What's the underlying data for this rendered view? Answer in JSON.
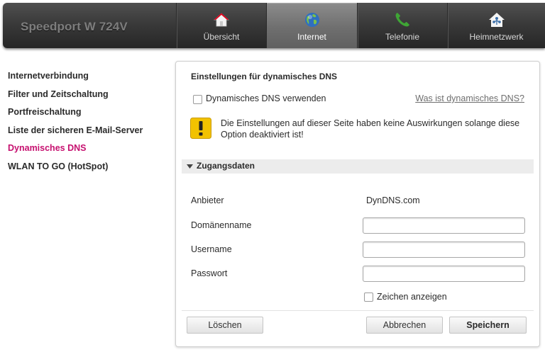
{
  "header": {
    "brand": "Speedport W 724V",
    "tabs": [
      {
        "label": "Übersicht",
        "icon": "home-icon",
        "active": false
      },
      {
        "label": "Internet",
        "icon": "globe-icon",
        "active": true
      },
      {
        "label": "Telefonie",
        "icon": "phone-icon",
        "active": false
      },
      {
        "label": "Heimnetzwerk",
        "icon": "home-network-icon",
        "active": false
      }
    ]
  },
  "sidebar": {
    "items": [
      {
        "label": "Internetverbindung",
        "active": false
      },
      {
        "label": "Filter und Zeitschaltung",
        "active": false
      },
      {
        "label": "Portfreischaltung",
        "active": false
      },
      {
        "label": "Liste der sicheren E-Mail-Server",
        "active": false
      },
      {
        "label": "Dynamisches DNS",
        "active": true
      },
      {
        "label": "WLAN TO GO (HotSpot)",
        "active": false
      }
    ]
  },
  "panel": {
    "title": "Einstellungen für dynamisches DNS",
    "enable_checkbox": {
      "label": "Dynamisches DNS verwenden",
      "checked": false
    },
    "help_link": "Was ist dynamisches DNS?",
    "warning": {
      "icon": "warning-icon",
      "text": "Die Einstellungen auf dieser Seite haben keine Auswirkungen solange diese Option deaktiviert ist!"
    },
    "section": {
      "title": "Zugangsdaten",
      "expanded": true
    },
    "fields": {
      "provider": {
        "label": "Anbieter",
        "value": "DynDNS.com"
      },
      "domain": {
        "label": "Domänenname",
        "value": ""
      },
      "username": {
        "label": "Username",
        "value": ""
      },
      "password": {
        "label": "Passwort",
        "value": ""
      }
    },
    "show_chars_checkbox": {
      "label": "Zeichen anzeigen",
      "checked": false
    },
    "buttons": {
      "delete": "Löschen",
      "cancel": "Abbrechen",
      "save": "Speichern"
    }
  },
  "colors": {
    "accent": "#c6106f",
    "topbar": "#333333",
    "active_tab": "#7a7a7a"
  }
}
